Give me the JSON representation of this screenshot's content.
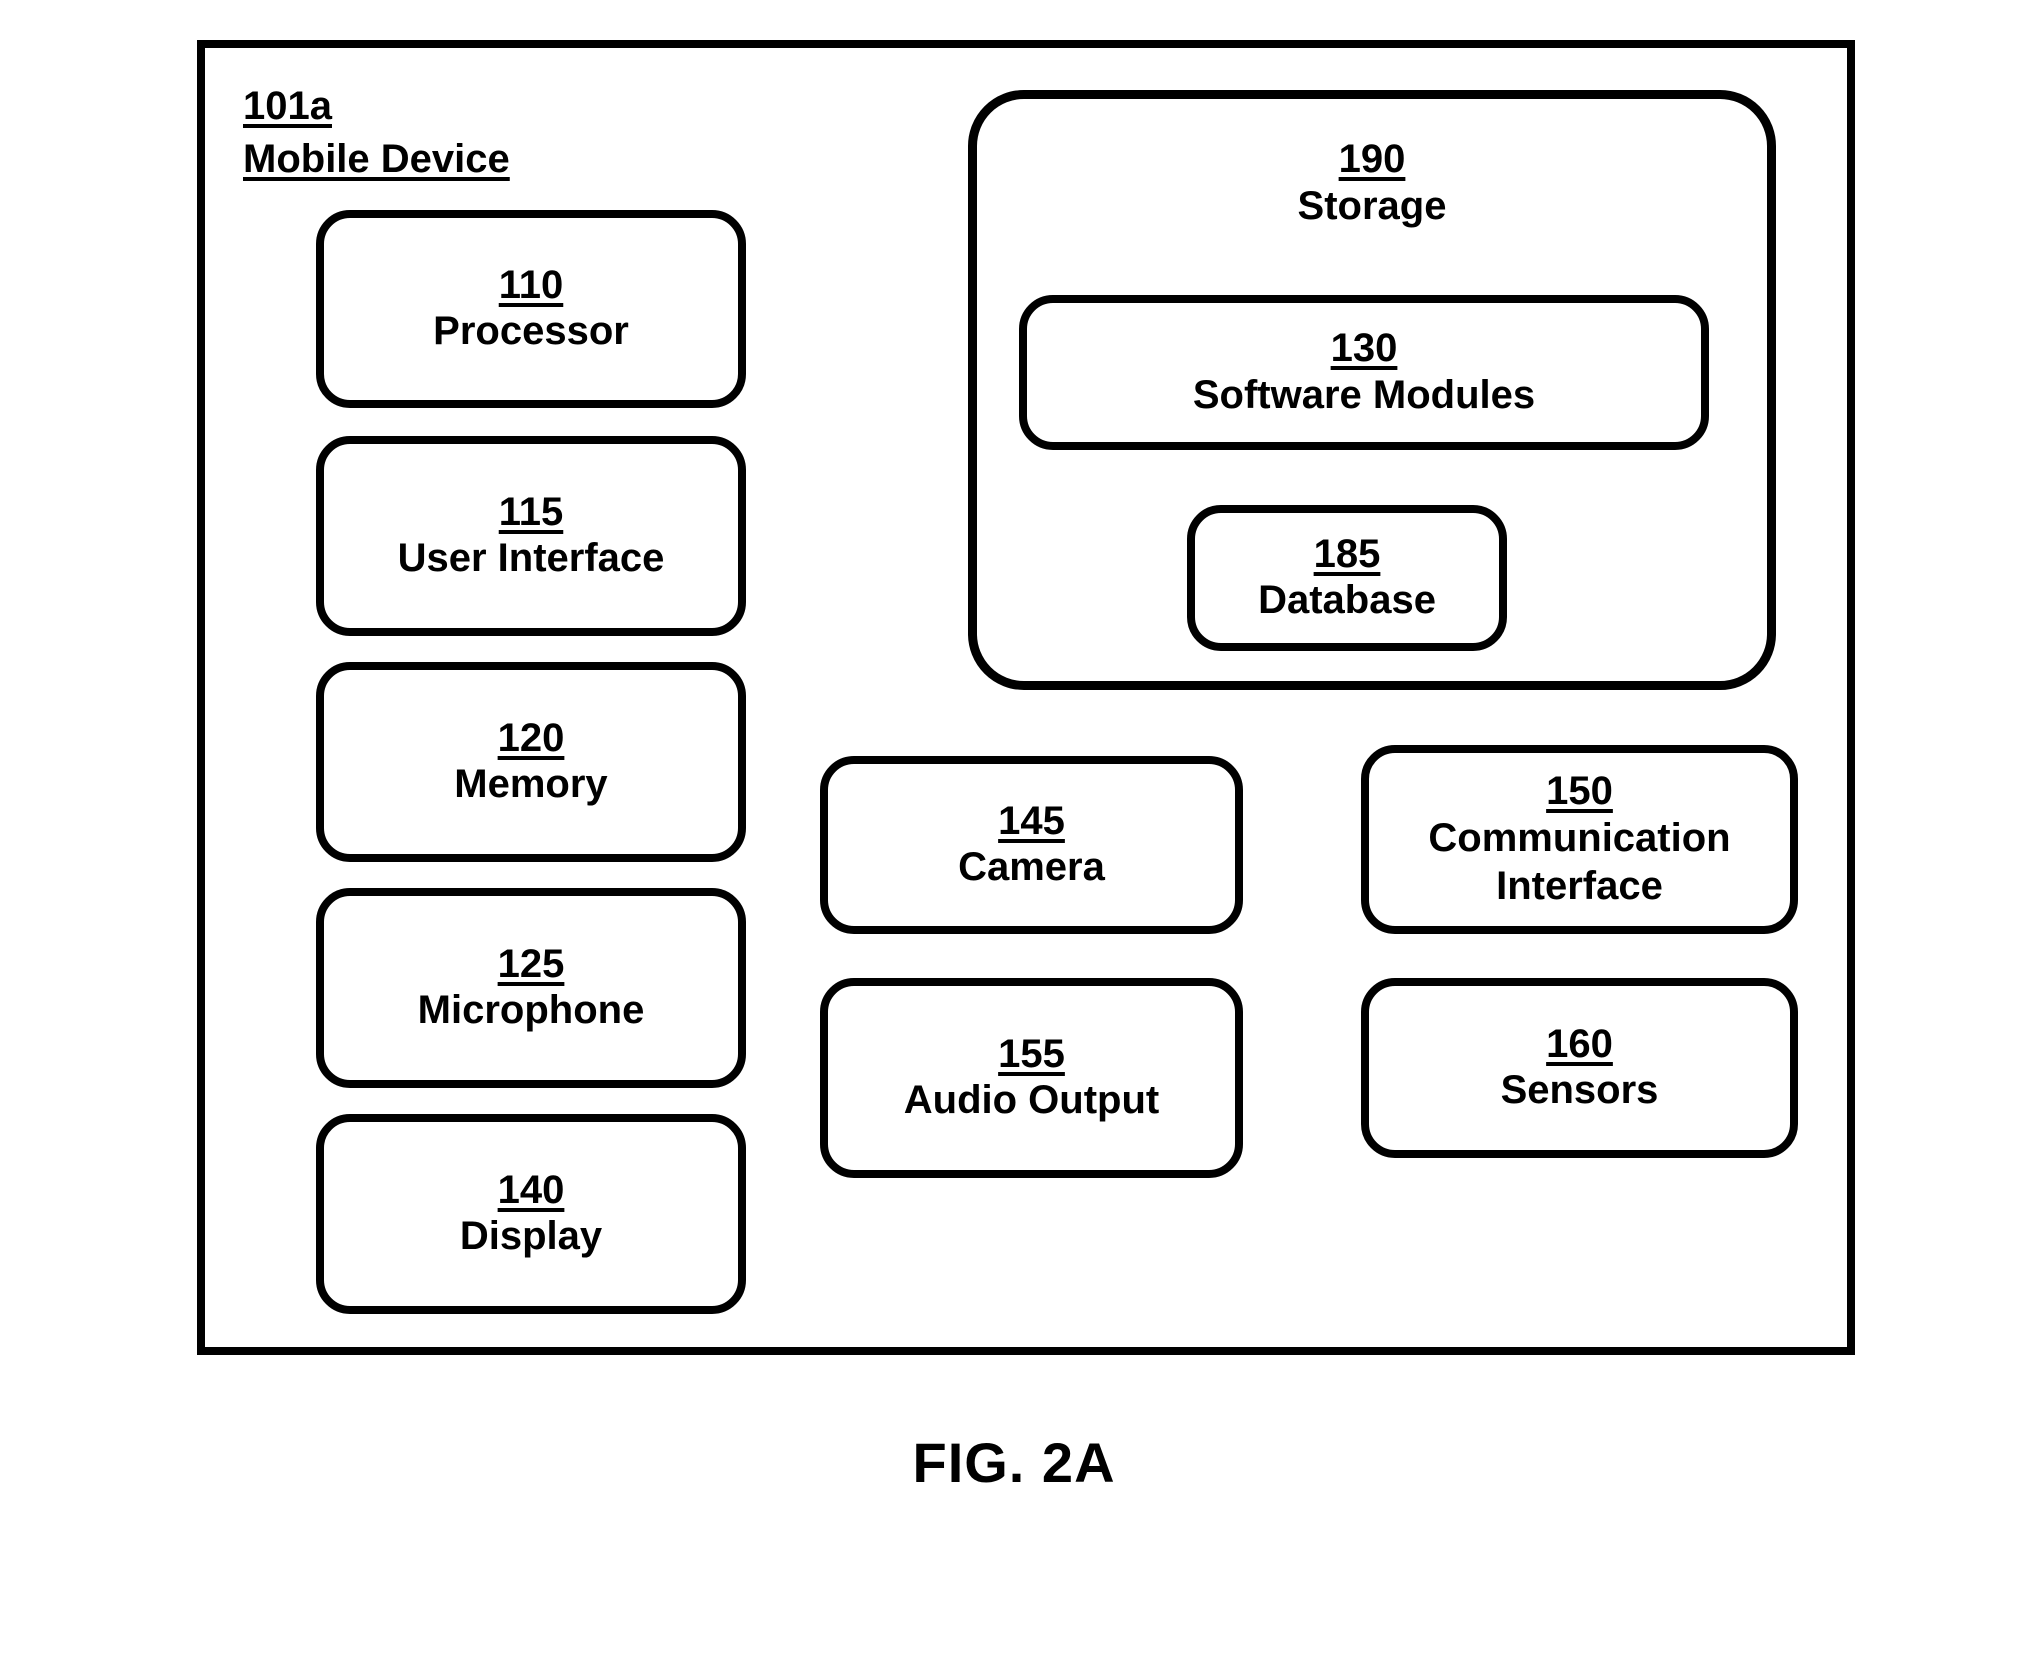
{
  "figure": {
    "caption": "FIG. 2A"
  },
  "device": {
    "ref": "101a",
    "name": "Mobile Device"
  },
  "components": {
    "processor": {
      "ref": "110",
      "label": "Processor"
    },
    "user_interface": {
      "ref": "115",
      "label": "User Interface"
    },
    "memory": {
      "ref": "120",
      "label": "Memory"
    },
    "microphone": {
      "ref": "125",
      "label": "Microphone"
    },
    "display": {
      "ref": "140",
      "label": "Display"
    },
    "camera": {
      "ref": "145",
      "label": "Camera"
    },
    "audio_output": {
      "ref": "155",
      "label": "Audio Output"
    },
    "communication_interface": {
      "ref": "150",
      "label": "Communication\nInterface"
    },
    "sensors": {
      "ref": "160",
      "label": "Sensors"
    },
    "storage": {
      "ref": "190",
      "label": "Storage"
    },
    "software_modules": {
      "ref": "130",
      "label": "Software Modules"
    },
    "database": {
      "ref": "185",
      "label": "Database"
    }
  },
  "style": {
    "line_color": "#000000",
    "background_color": "#ffffff"
  }
}
